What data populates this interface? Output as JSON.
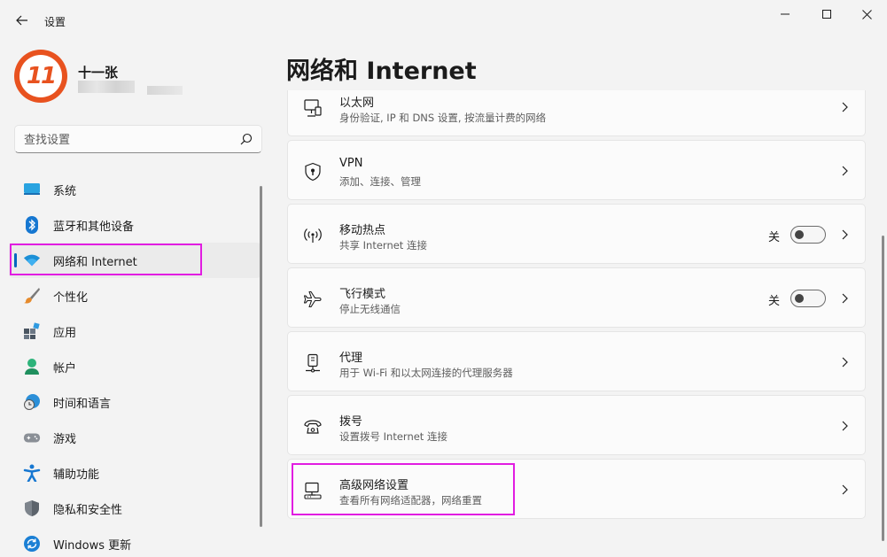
{
  "app": {
    "title": "设置"
  },
  "window_controls": {
    "minimize": "minimize-icon",
    "maximize": "maximize-icon",
    "close": "close-icon"
  },
  "profile": {
    "name": "十一张",
    "avatar_text": "11",
    "avatar_color": "#e8521f"
  },
  "search": {
    "placeholder": "查找设置"
  },
  "sidebar": {
    "items": [
      {
        "label": "系统",
        "icon": "monitor-icon"
      },
      {
        "label": "蓝牙和其他设备",
        "icon": "bluetooth-icon"
      },
      {
        "label": "网络和 Internet",
        "icon": "wifi-icon",
        "active": true
      },
      {
        "label": "个性化",
        "icon": "brush-icon"
      },
      {
        "label": "应用",
        "icon": "apps-icon"
      },
      {
        "label": "帐户",
        "icon": "person-icon"
      },
      {
        "label": "时间和语言",
        "icon": "globe-clock-icon"
      },
      {
        "label": "游戏",
        "icon": "gamepad-icon"
      },
      {
        "label": "辅助功能",
        "icon": "accessibility-icon"
      },
      {
        "label": "隐私和安全性",
        "icon": "shield-icon"
      },
      {
        "label": "Windows 更新",
        "icon": "update-icon"
      }
    ]
  },
  "page": {
    "title": "网络和 Internet"
  },
  "cards": [
    {
      "title": "以太网",
      "desc": "身份验证, IP 和 DNS 设置, 按流量计费的网络",
      "icon": "ethernet-icon"
    },
    {
      "title": "VPN",
      "desc": "添加、连接、管理",
      "icon": "vpn-shield-icon"
    },
    {
      "title": "移动热点",
      "desc": "共享 Internet 连接",
      "icon": "hotspot-icon",
      "toggle": "关",
      "toggle_on": false
    },
    {
      "title": "飞行模式",
      "desc": "停止无线通信",
      "icon": "airplane-icon",
      "toggle": "关",
      "toggle_on": false
    },
    {
      "title": "代理",
      "desc": "用于 Wi-Fi 和以太网连接的代理服务器",
      "icon": "proxy-icon"
    },
    {
      "title": "拨号",
      "desc": "设置拨号 Internet 连接",
      "icon": "dialup-icon"
    },
    {
      "title": "高级网络设置",
      "desc": "查看所有网络适配器，网络重置",
      "icon": "network-adapter-icon"
    }
  ],
  "colors": {
    "accent": "#0067c0",
    "highlight": "#e11de1",
    "background": "#f3f3f3"
  }
}
